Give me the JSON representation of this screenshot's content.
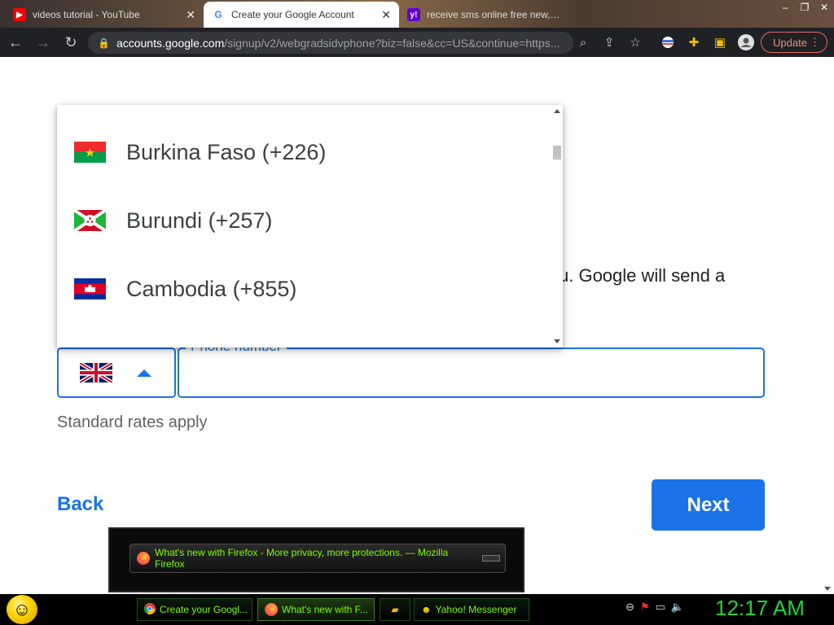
{
  "browser": {
    "tabs": [
      {
        "title": "videos tutorial - YouTube",
        "favicon": "youtube-icon",
        "active": false
      },
      {
        "title": "Create your Google Account",
        "favicon": "google-icon",
        "active": true
      },
      {
        "title": "receive sms online free new, num",
        "favicon": "yahoo-icon",
        "active": false
      }
    ],
    "url_host": "accounts.google.com",
    "url_path": "/signup/v2/webgradsidvphone?biz=false&cc=US&continue=https...",
    "update_label": "Update"
  },
  "page": {
    "partial_text": "u. Google will send a",
    "phone_label": "Phone number",
    "phone_value": "",
    "selected_country_flag": "uk-flag",
    "rates_text": "Standard rates apply",
    "back_label": "Back",
    "next_label": "Next",
    "country_list": [
      {
        "label": "Burkina Faso (+226)",
        "flag": "burkina-faso-flag"
      },
      {
        "label": "Burundi (+257)",
        "flag": "burundi-flag"
      },
      {
        "label": "Cambodia (+855)",
        "flag": "cambodia-flag"
      }
    ]
  },
  "notification": {
    "text": "What's new with Firefox - More privacy, more protections. — Mozilla Firefox"
  },
  "taskbar": {
    "items": [
      {
        "label": "Create your Googl...",
        "icon": "chrome-icon"
      },
      {
        "label": "What's new with F...",
        "icon": "firefox-icon"
      },
      {
        "label": "",
        "icon": "folder-icon"
      },
      {
        "label": "Yahoo! Messenger",
        "icon": "yahoo-messenger-icon"
      }
    ],
    "clock": "12:17 AM"
  },
  "colors": {
    "accent": "#1a73e8",
    "taskbar_text": "#7CFC00",
    "clock": "#22d33a"
  }
}
